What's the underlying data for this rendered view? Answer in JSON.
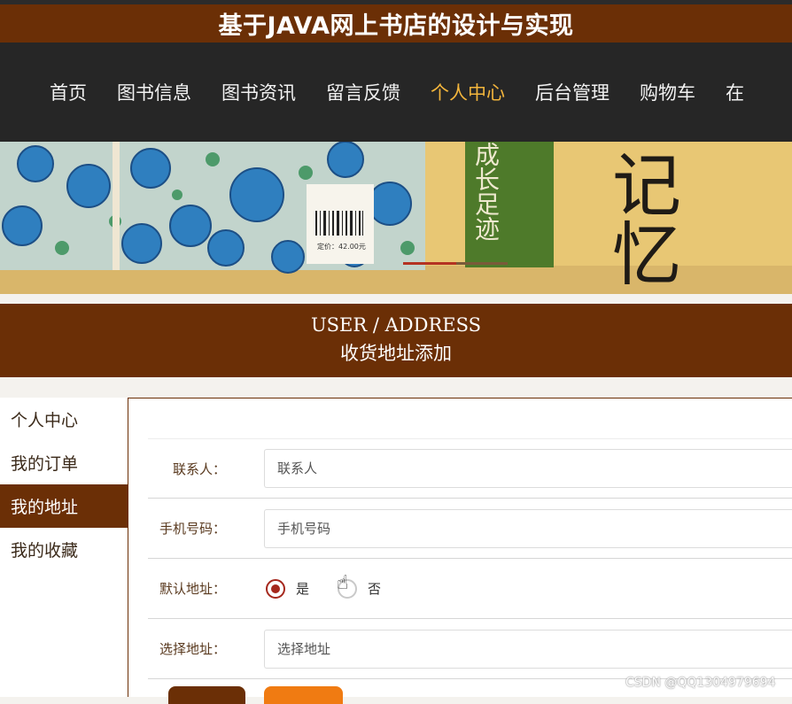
{
  "header": {
    "site_title": "基于JAVA网上书店的设计与实现"
  },
  "nav": {
    "items": [
      {
        "label": "首页"
      },
      {
        "label": "图书信息"
      },
      {
        "label": "图书资讯"
      },
      {
        "label": "留言反馈"
      },
      {
        "label": "个人中心",
        "active": true
      },
      {
        "label": "后台管理"
      },
      {
        "label": "购物车"
      },
      {
        "label": "在"
      }
    ]
  },
  "banner": {
    "text_1": "成长足迹",
    "text_2": "记忆",
    "price_text": "定价：42.00元"
  },
  "section": {
    "title_en": "USER / ADDRESS",
    "title_cn": "收货地址添加"
  },
  "sidebar": {
    "items": [
      {
        "label": "个人中心"
      },
      {
        "label": "我的订单"
      },
      {
        "label": "我的地址",
        "active": true
      },
      {
        "label": "我的收藏"
      }
    ]
  },
  "form": {
    "contact": {
      "label": "联系人：",
      "placeholder": "联系人"
    },
    "phone": {
      "label": "手机号码：",
      "placeholder": "手机号码"
    },
    "default": {
      "label": "默认地址：",
      "yes": "是",
      "no": "否",
      "selected": "是"
    },
    "address": {
      "label": "选择地址：",
      "placeholder": "选择地址"
    }
  },
  "watermark": "CSDN @QQ1304979694",
  "colors": {
    "brand": "#6b2f06",
    "nav_bg": "#262626",
    "active_nav": "#f3b53c",
    "reset_button": "#f07b12"
  }
}
